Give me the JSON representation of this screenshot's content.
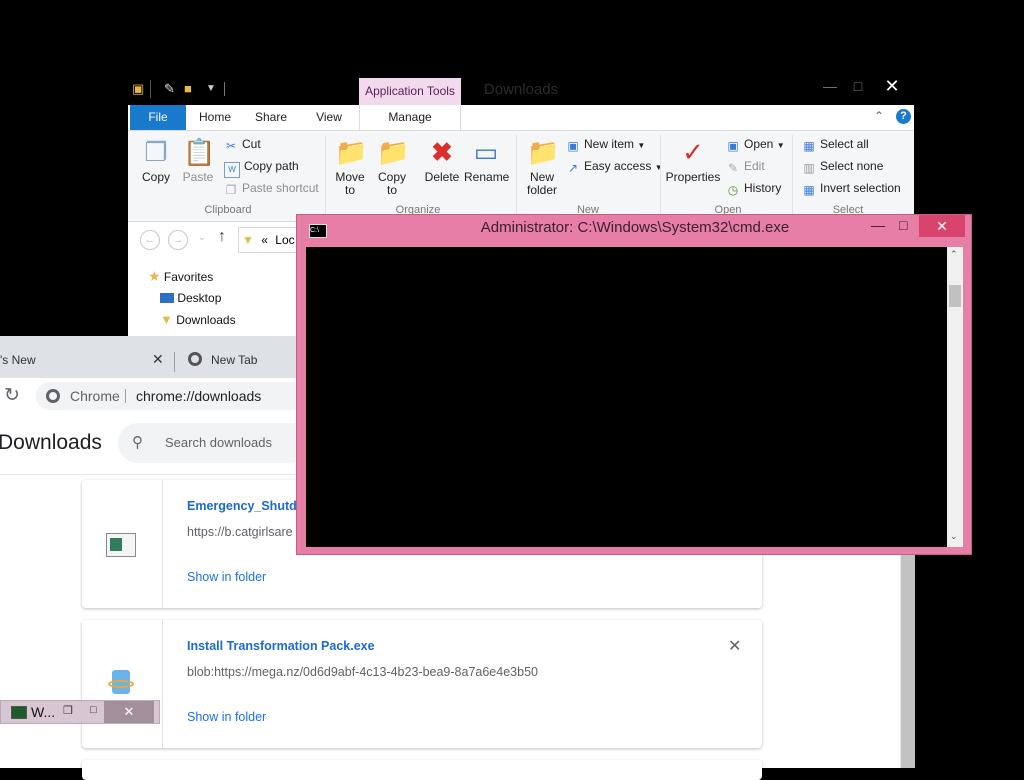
{
  "explorer": {
    "title": "Downloads",
    "app_tools": "Application Tools",
    "tabs": {
      "file": "File",
      "home": "Home",
      "share": "Share",
      "view": "View",
      "manage": "Manage"
    },
    "clipboard": {
      "copy": "Copy",
      "paste": "Paste",
      "cut": "Cut",
      "copy_path": "Copy path",
      "paste_shortcut": "Paste shortcut",
      "group": "Clipboard"
    },
    "organize": {
      "move_to": "Move to",
      "copy_to": "Copy to",
      "delete": "Delete",
      "rename": "Rename",
      "group": "Organize"
    },
    "new": {
      "new_folder": "New folder",
      "new_item": "New item",
      "easy_access": "Easy access",
      "group": "New"
    },
    "open": {
      "properties": "Properties",
      "open": "Open",
      "edit": "Edit",
      "history": "History",
      "group": "Open"
    },
    "select": {
      "select_all": "Select all",
      "select_none": "Select none",
      "invert": "Invert selection",
      "group": "Select"
    },
    "address": {
      "prefix": "«",
      "text": "Loc"
    },
    "nav": {
      "favorites": "Favorites",
      "desktop": "Desktop",
      "downloads": "Downloads"
    }
  },
  "chrome": {
    "tab1": "'s New",
    "tab2": "New Tab",
    "omnibox_site": "Chrome",
    "omnibox_url": "chrome://downloads",
    "page_title": "Downloads",
    "search_placeholder": "Search downloads",
    "downloads": [
      {
        "name": "Emergency_Shutdo",
        "url": "https://b.catgirlsare",
        "link": "Show in folder"
      },
      {
        "name": "Install Transformation Pack.exe",
        "url": "blob:https://mega.nz/0d6d9abf-4c13-4b23-bea9-8a7a6e4e3b50",
        "link": "Show in folder"
      }
    ]
  },
  "cmd": {
    "title": "Administrator: C:\\Windows\\System32\\cmd.exe"
  },
  "mini_window": {
    "label": "W..."
  },
  "colors": {
    "cmd_frame": "#e77ea6",
    "file_tab": "#1979ca",
    "app_tools": "#f3d9ee",
    "link": "#1a73e8"
  }
}
